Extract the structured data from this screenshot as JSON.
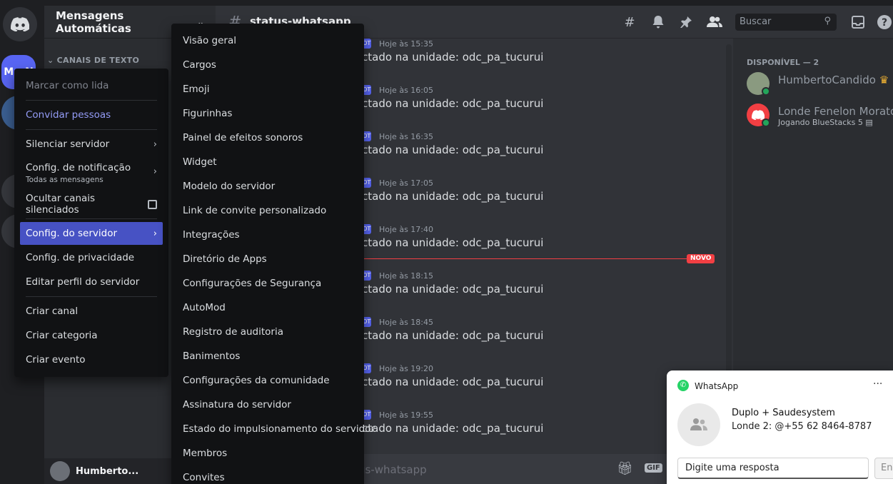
{
  "rail": {
    "active_server_label": "M...N"
  },
  "sidebar": {
    "guild_name": "Mensagens Automáticas",
    "category": "CANAIS DE TEXTO",
    "user_name": "Humberto..."
  },
  "header": {
    "channel_name": "status-whatsapp",
    "search_placeholder": "Buscar"
  },
  "messages": [
    {
      "time": "Hoje às 15:35",
      "text": "ctado na unidade: odc_pa_tucurui"
    },
    {
      "time": "Hoje às 16:05",
      "text": "ctado na unidade: odc_pa_tucurui"
    },
    {
      "time": "Hoje às 16:35",
      "text": "ctado na unidade: odc_pa_tucurui"
    },
    {
      "time": "Hoje às 17:05",
      "text": "ctado na unidade: odc_pa_tucurui"
    },
    {
      "time": "Hoje às 17:40",
      "text": "ctado na unidade: odc_pa_tucurui"
    },
    {
      "time": "Hoje às 18:15",
      "text": "ctado na unidade: odc_pa_tucurui"
    },
    {
      "time": "Hoje às 18:45",
      "text": "ctado na unidade: odc_pa_tucurui"
    },
    {
      "time": "Hoje às 19:20",
      "text": "ctado na unidade: odc_pa_tucurui"
    },
    {
      "time": "Hoje às 19:55",
      "text": "ctado na unidade: odc_pa_tucurui"
    }
  ],
  "bot_tag": "BOT",
  "new_divider": "NOVO",
  "composer": {
    "placeholder": "us-whatsapp",
    "gif_label": "GIF"
  },
  "members": {
    "header": "DISPONÍVEL — 2",
    "list": [
      {
        "name": "HumbertoCandido",
        "activity": ""
      },
      {
        "name": "Londe Fenelon Morato",
        "activity": "Jogando BlueStacks 5"
      }
    ]
  },
  "context_menu": {
    "mark_read": "Marcar como lida",
    "invite": "Convidar pessoas",
    "mute": "Silenciar servidor",
    "notif": "Config. de notificação",
    "notif_sub": "Todas as mensagens",
    "hide_muted": "Ocultar canais silenciados",
    "server_settings": "Config. do servidor",
    "privacy": "Config. de privacidade",
    "edit_profile": "Editar perfil do servidor",
    "create_channel": "Criar canal",
    "create_category": "Criar categoria",
    "create_event": "Criar evento"
  },
  "submenu": [
    "Visão geral",
    "Cargos",
    "Emoji",
    "Figurinhas",
    "Painel de efeitos sonoros",
    "Widget",
    "Modelo do servidor",
    "Link de convite personalizado",
    "Integrações",
    "Diretório de Apps",
    "Configurações de Segurança",
    "AutoMod",
    "Registro de auditoria",
    "Banimentos",
    "Configurações da comunidade",
    "Assinatura do servidor",
    "Estado do impulsionamento do servidor",
    "Membros",
    "Convites"
  ],
  "toast": {
    "app": "WhatsApp",
    "title": "Duplo + Saudesystem",
    "body": "Londe 2: @+55 62 8464-8787",
    "reply_placeholder": "Digite uma resposta",
    "send_label": "Env"
  },
  "colors": {
    "accent": "#5865f2",
    "active_item": "#4752c4",
    "new_divider": "#f23f43",
    "online": "#23a55a",
    "whatsapp": "#25d366"
  }
}
